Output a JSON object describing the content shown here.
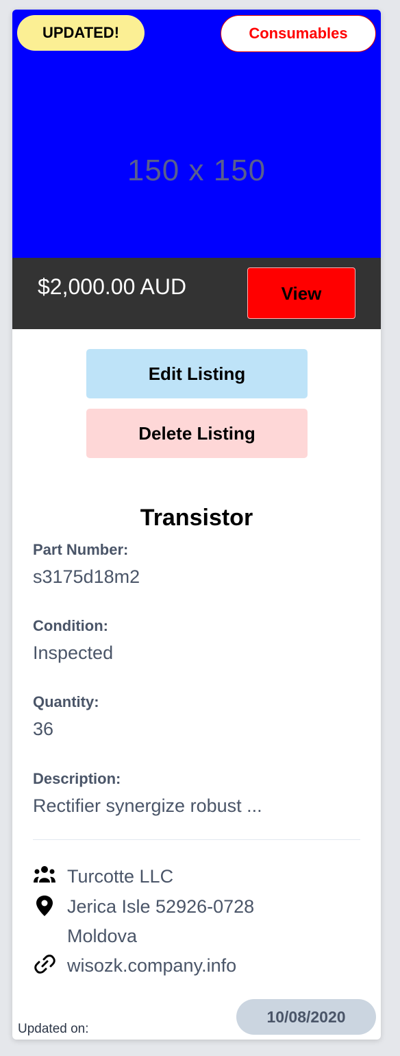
{
  "badges": {
    "status": "UPDATED!",
    "category": "Consumables"
  },
  "image": {
    "placeholder": "150 x 150"
  },
  "price_bar": {
    "price": "$2,000.00 AUD",
    "view_label": "View"
  },
  "actions": {
    "edit_label": "Edit Listing",
    "delete_label": "Delete Listing"
  },
  "listing": {
    "title": "Transistor",
    "fields": [
      {
        "label": "Part Number:",
        "value": "s3175d18m2"
      },
      {
        "label": "Condition:",
        "value": "Inspected"
      },
      {
        "label": "Quantity:",
        "value": "36"
      },
      {
        "label": "Description:",
        "value": "Rectifier synergize robust ..."
      }
    ]
  },
  "company": {
    "name": "Turcotte LLC",
    "address_line1": "Jerica Isle 52926-0728",
    "address_line2": "Moldova",
    "website": "wisozk.company.info"
  },
  "footer": {
    "updated_label": "Updated on:",
    "date": "10/08/2020"
  },
  "colors": {
    "image_bg": "#0000ff",
    "status_badge": "#fbef94",
    "category_text": "#ff0000",
    "price_bar": "#333333",
    "view_button": "#ff0000",
    "edit_button": "#bee3f8",
    "delete_button": "#fed7d7",
    "date_pill": "#cbd5e0"
  },
  "icons": {
    "company": "users-icon",
    "address": "map-pin-icon",
    "website": "link-icon"
  }
}
